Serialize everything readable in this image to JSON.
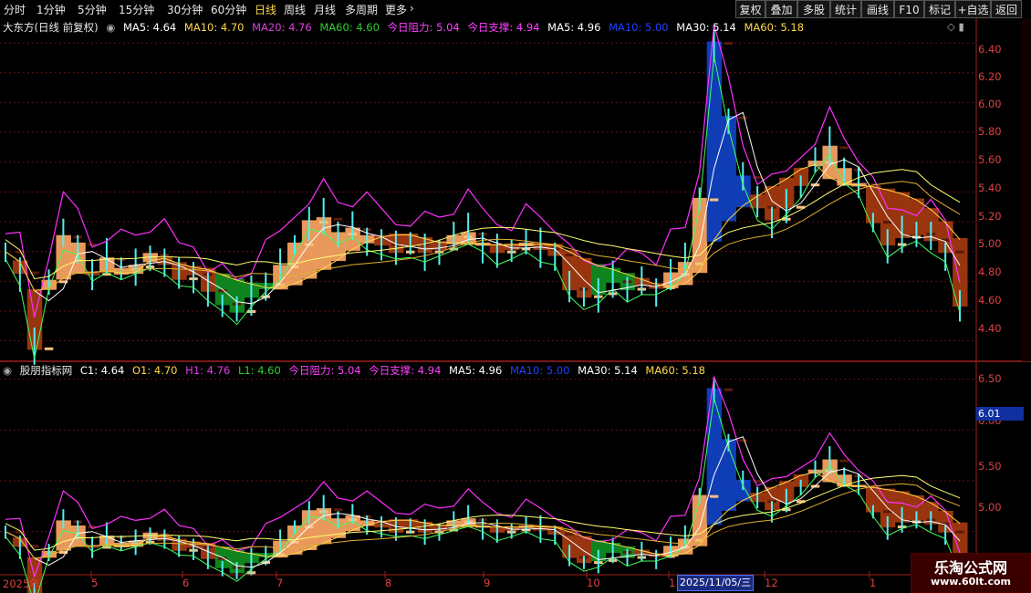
{
  "toolbar": {
    "timeframes": [
      "分时",
      "1分钟",
      "5分钟",
      "15分钟",
      "30分钟",
      "60分钟",
      "日线",
      "周线",
      "月线",
      "多周期",
      "更多"
    ],
    "active": "日线",
    "more_chevron": "›",
    "right_buttons": [
      "复权",
      "叠加",
      "多股",
      "统计",
      "画线",
      "F10",
      "标记",
      "+自选",
      "返回"
    ]
  },
  "panel1": {
    "title": "大东方(日线 前复权)",
    "items": [
      {
        "text": "MA5: 4.64",
        "color": "#ffffff"
      },
      {
        "text": "MA10: 4.70",
        "color": "#ffd84a"
      },
      {
        "text": "MA20: 4.76",
        "color": "#e040e0"
      },
      {
        "text": "MA60: 4.60",
        "color": "#30d030"
      },
      {
        "text": "今日阻力: 5.04",
        "color": "#ff40ff"
      },
      {
        "text": "今日支撑: 4.94",
        "color": "#ff40ff"
      },
      {
        "text": "MA5: 4.96",
        "color": "#ffffff"
      },
      {
        "text": "MA10: 5.00",
        "color": "#2040ff"
      },
      {
        "text": "MA30: 5.14",
        "color": "#ffffff"
      },
      {
        "text": "MA60: 5.18",
        "color": "#ffd84a"
      }
    ],
    "yticks": [
      "6.40",
      "6.20",
      "6.00",
      "5.80",
      "5.60",
      "5.40",
      "5.20",
      "5.00",
      "4.80",
      "4.60",
      "4.40"
    ]
  },
  "panel2": {
    "title": "股朋指标网",
    "items": [
      {
        "text": "C1: 4.64",
        "color": "#ffffff"
      },
      {
        "text": "O1: 4.70",
        "color": "#ffd84a"
      },
      {
        "text": "H1: 4.76",
        "color": "#e040e0"
      },
      {
        "text": "L1: 4.60",
        "color": "#30d030"
      },
      {
        "text": "今日阻力: 5.04",
        "color": "#ff40ff"
      },
      {
        "text": "今日支撑: 4.94",
        "color": "#ff40ff"
      },
      {
        "text": "MA5: 4.96",
        "color": "#ffffff"
      },
      {
        "text": "MA10: 5.00",
        "color": "#2040ff"
      },
      {
        "text": "MA30: 5.14",
        "color": "#ffffff"
      },
      {
        "text": "MA60: 5.18",
        "color": "#ffd84a"
      }
    ],
    "yticks": [
      "6.50",
      "6.00",
      "5.50",
      "5.00"
    ],
    "price_tag": "6.01"
  },
  "xaxis": {
    "labels": [
      "2025年",
      "5",
      "6",
      "7",
      "8",
      "9",
      "10",
      "1",
      "12",
      "1"
    ],
    "date_box": "2025/11/05/三"
  },
  "watermark": {
    "line1": "乐淘公式网",
    "line2": "www.60lt.com"
  },
  "colors": {
    "up": "#f4a060",
    "down": "#a03810",
    "blue": "#1040c0",
    "green": "#108a20",
    "cyan": "#50f0f0",
    "grid": "#6a1010"
  },
  "chart_data": {
    "type": "line",
    "series": [
      {
        "values": [
          5.0,
          4.86,
          4.35,
          4.8,
          5.1,
          5.05,
          4.85,
          4.95,
          4.88,
          4.9,
          4.98,
          4.92,
          4.82,
          4.85,
          4.74,
          4.65,
          4.6,
          4.7,
          4.78,
          4.9,
          5.05,
          5.2,
          5.22,
          5.12,
          5.15,
          5.1,
          5.05,
          5.0,
          5.05,
          5.0,
          5.02,
          5.1,
          5.12,
          5.05,
          5.0,
          5.02,
          5.05,
          5.02,
          4.98,
          4.75,
          4.7,
          4.72,
          4.8,
          4.75,
          4.78,
          4.76,
          4.85,
          4.92,
          5.35,
          6.4,
          5.9,
          5.5,
          5.3,
          5.22,
          5.3,
          5.45,
          5.6,
          5.7,
          5.55,
          5.45,
          5.2,
          5.05,
          5.1,
          5.12,
          5.08,
          5.0,
          4.64
        ]
      }
    ],
    "ylim": [
      4.3,
      6.5
    ]
  }
}
